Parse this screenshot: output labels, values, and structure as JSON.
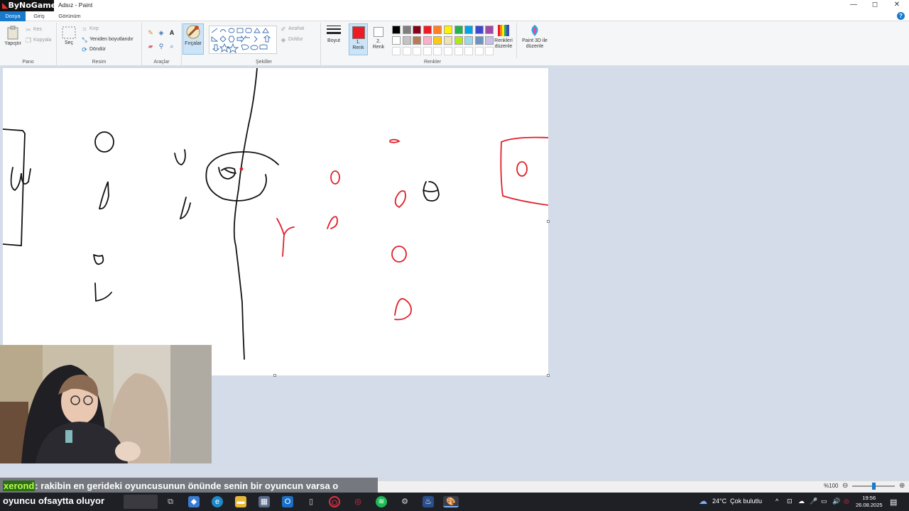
{
  "app": {
    "brand": "ByNoGame",
    "window_title": "Adsız - Paint",
    "controls": {
      "minimize": "—",
      "maximize": "◻",
      "close": "✕"
    }
  },
  "tabs": [
    {
      "label": "Dosya"
    },
    {
      "label": "Giriş"
    },
    {
      "label": "Görünüm"
    }
  ],
  "ribbon": {
    "pano": {
      "label": "Pano",
      "paste": "Yapıştır",
      "cut": "Kes",
      "copy": "Kopyala"
    },
    "resim": {
      "label": "Resim",
      "select": "Seç",
      "crop": "Kırp",
      "resize": "Yeniden boyutlandır",
      "rotate": "Döndür"
    },
    "araclar": {
      "label": "Araçlar"
    },
    "brushes": "Fırçalar",
    "sekiller": {
      "label": "Şekiller",
      "outline": "Anahat",
      "fill": "Doldur"
    },
    "size": "Boyut",
    "color1": "1. Renk",
    "color2": "2. Renk",
    "renkler": {
      "label": "Renkler"
    },
    "edit_colors": "Renkleri düzenle",
    "paint3d": "Paint 3D ile düzenle"
  },
  "palette": {
    "row1": [
      "#000000",
      "#7f7f7f",
      "#880015",
      "#ed1c24",
      "#ff7f27",
      "#fff200",
      "#22b14c",
      "#00a2e8",
      "#3f48cc",
      "#a349a4"
    ],
    "row2": [
      "#ffffff",
      "#c3c3c3",
      "#b97a57",
      "#ffaec9",
      "#ffc90e",
      "#efe4b0",
      "#b5e61d",
      "#99d9ea",
      "#7092be",
      "#c8bfe7"
    ],
    "color1": "#ed1c24",
    "color2": "#ffffff"
  },
  "chat": {
    "user": "xerond",
    "message_line1": ": rakibin en gerideki oyuncusunun önünde senin bir oyuncun varsa o",
    "message_line2": "oyuncu ofsaytta oluyor"
  },
  "status": {
    "zoom": "%100",
    "zoom_level": 1.0
  },
  "taskbar": {
    "weather_temp": "24°C",
    "weather_text": "Çok bulutlu",
    "time": "19:56",
    "date": "26.08.2025"
  }
}
